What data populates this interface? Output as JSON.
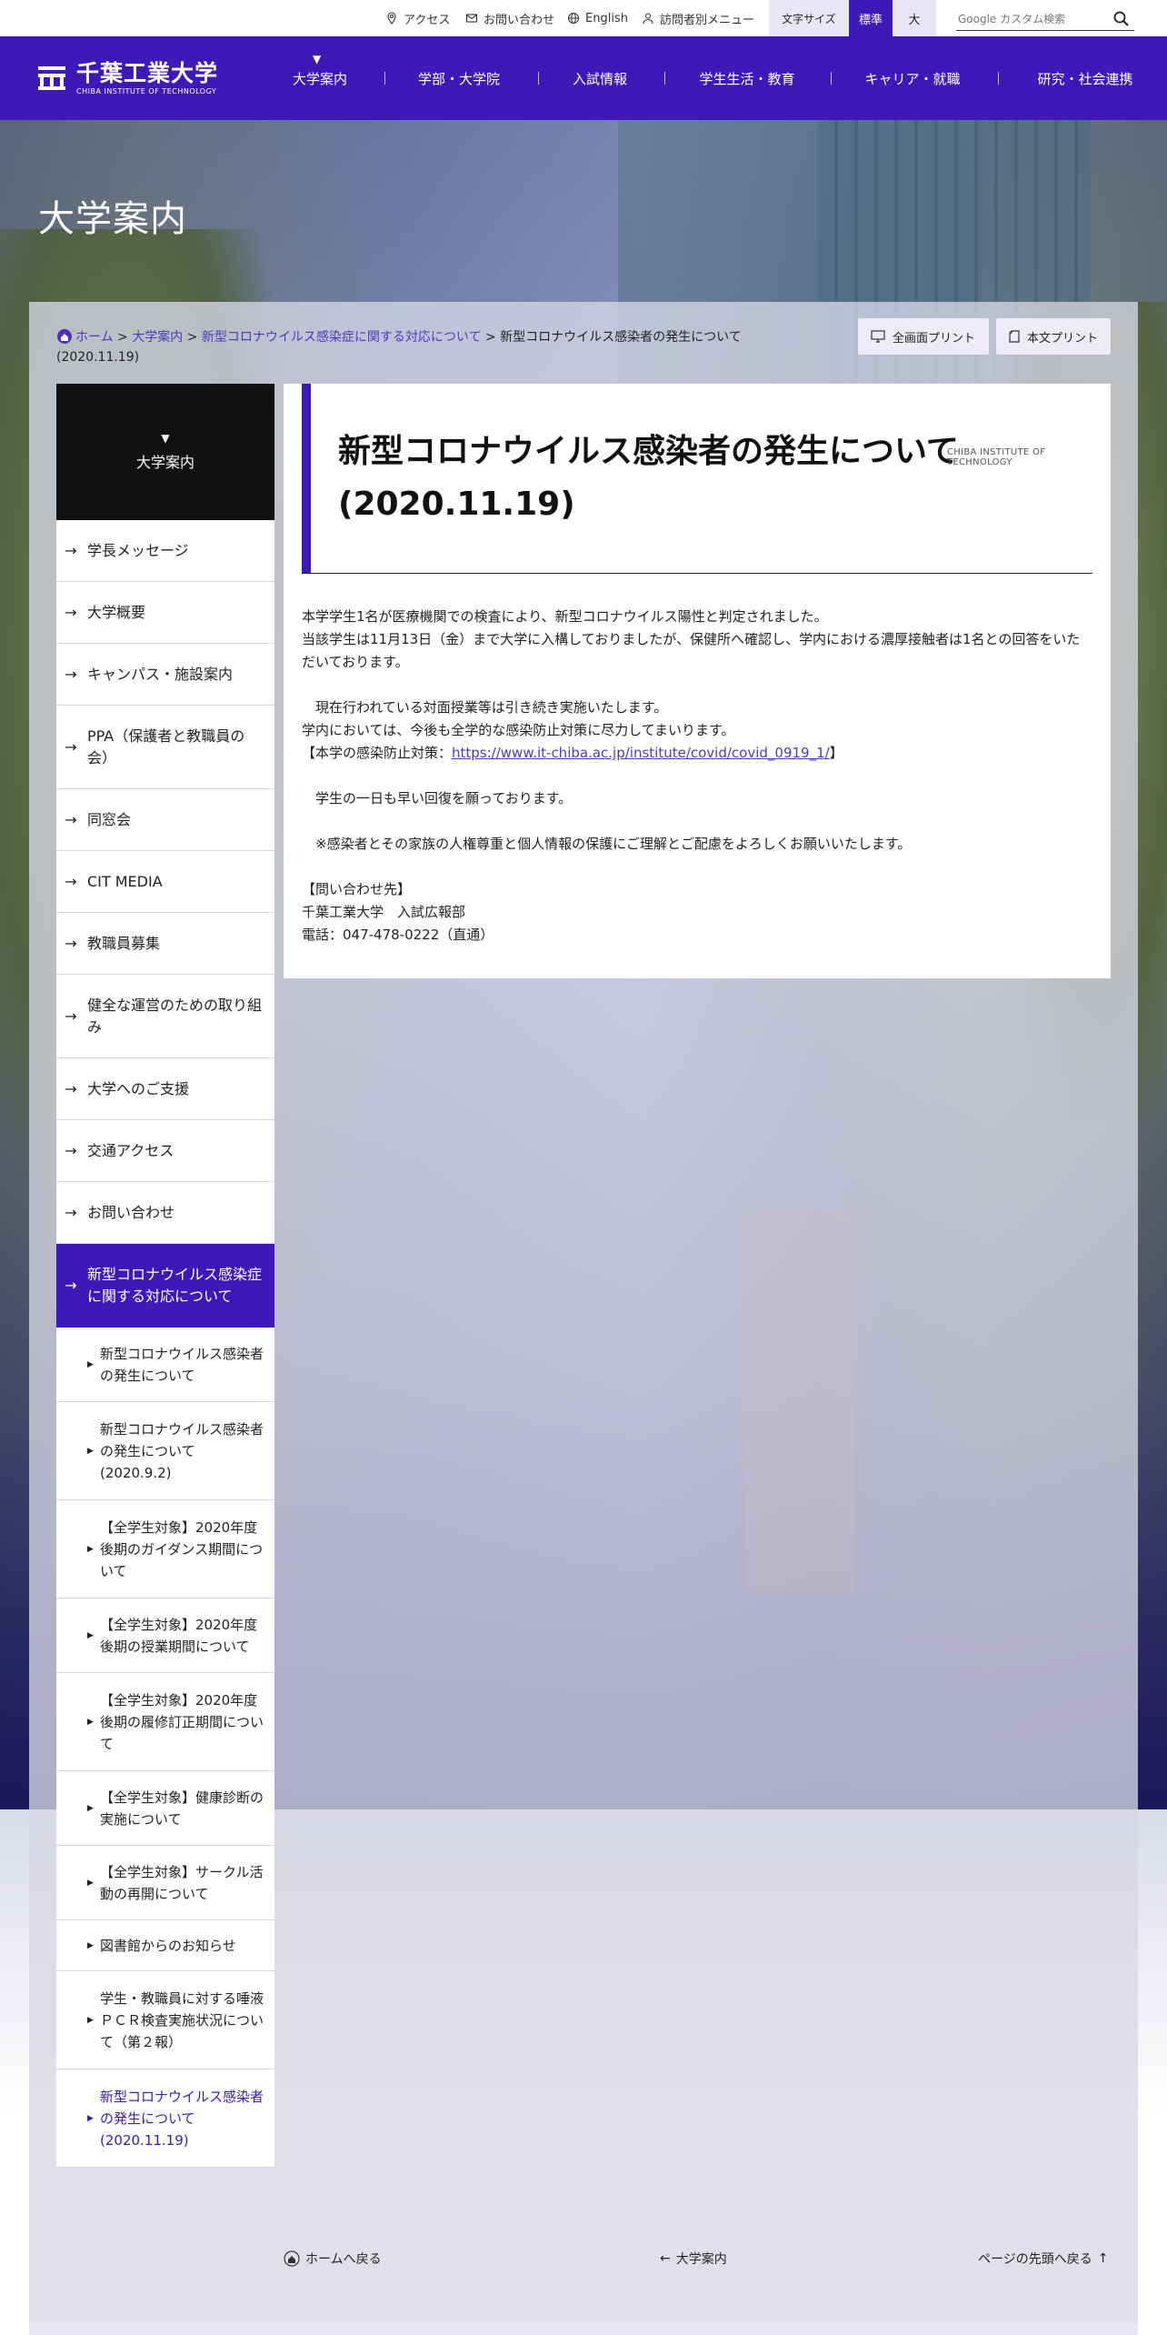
{
  "utility": {
    "access": "アクセス",
    "contact": "お問い合わせ",
    "english": "English",
    "visitor_menu": "訪問者別メニュー",
    "font_size_label": "文字サイズ",
    "font_size_standard": "標準",
    "font_size_large": "大",
    "search_placeholder": "Google カスタム検索"
  },
  "logo": {
    "jp": "千葉工業大学",
    "en": "CHIBA INSTITUTE OF TECHNOLOGY"
  },
  "nav": [
    {
      "label": "大学案内"
    },
    {
      "label": "学部・大学院"
    },
    {
      "label": "入試情報"
    },
    {
      "label": "学生生活・教育"
    },
    {
      "label": "キャリア・就職"
    },
    {
      "label": "研究・社会連携"
    }
  ],
  "page_title": "大学案内",
  "breadcrumb": {
    "home": "ホーム",
    "sep": " > ",
    "level1": "大学案内",
    "level2": "新型コロナウイルス感染症に関する対応について",
    "current": "新型コロナウイルス感染者の発生について(2020.11.19)"
  },
  "print": {
    "full": "全画面プリント",
    "body": "本文プリント"
  },
  "sidebar": {
    "head": "大学案内",
    "items": [
      {
        "label": "学長メッセージ"
      },
      {
        "label": "大学概要"
      },
      {
        "label": "キャンパス・施設案内"
      },
      {
        "label": "PPA（保護者と教職員の会）"
      },
      {
        "label": "同窓会"
      },
      {
        "label": "CIT MEDIA"
      },
      {
        "label": "教職員募集"
      },
      {
        "label": "健全な運営のための取り組み"
      },
      {
        "label": "大学へのご支援"
      },
      {
        "label": "交通アクセス"
      },
      {
        "label": "お問い合わせ"
      },
      {
        "label": "新型コロナウイルス感染症に関する対応について"
      }
    ],
    "sub_items": [
      {
        "label": "新型コロナウイルス感染者の発生について"
      },
      {
        "label": "新型コロナウイルス感染者の発生について(2020.9.2)"
      },
      {
        "label": "【全学生対象】2020年度後期のガイダンス期間について"
      },
      {
        "label": "【全学生対象】2020年度後期の授業期間について"
      },
      {
        "label": "【全学生対象】2020年度後期の履修訂正期間について"
      },
      {
        "label": "【全学生対象】健康診断の実施について"
      },
      {
        "label": "【全学生対象】サークル活動の再開について"
      },
      {
        "label": "図書館からのお知らせ"
      },
      {
        "label": "学生・教職員に対する唾液ＰＣＲ検査実施状況について（第２報）"
      },
      {
        "label": "新型コロナウイルス感染者の発生について(2020.11.19)"
      }
    ]
  },
  "article": {
    "title": "新型コロナウイルス感染者の発生について(2020.11.19)",
    "en_tag": "CHIBA INSTITUTE OF TECHNOLOGY",
    "p1": "本学学生1名が医療機関での検査により、新型コロナウイルス陽性と判定されました。",
    "p2": "当該学生は11月13日（金）まで大学に入構しておりましたが、保健所へ確認し、学内における濃厚接触者は1名との回答をいただいております。",
    "p3": "　現在行われている対面授業等は引き続き実施いたします。",
    "p4": "学内においては、今後も全学的な感染防止対策に尽力してまいります。",
    "p5_prefix": "【本学の感染防止対策：",
    "p5_link": "https://www.it-chiba.ac.jp/institute/covid/covid_0919_1/",
    "p5_suffix": "】",
    "p6": "　学生の一日も早い回復を願っております。",
    "p7": "　※感染者とその家族の人権尊重と個人情報の保護にご理解とご配慮をよろしくお願いいたします。",
    "contact_head": "【問い合わせ先】",
    "contact_org": "千葉工業大学　入試広報部",
    "contact_tel": "電話：047-478-0222（直通）"
  },
  "bottom_nav": {
    "home": "ホームへ戻る",
    "parent": "大学案内",
    "top": "ページの先頭へ戻る"
  },
  "colors": {
    "brand": "#3d1ab8",
    "link": "#4a3bbd"
  }
}
